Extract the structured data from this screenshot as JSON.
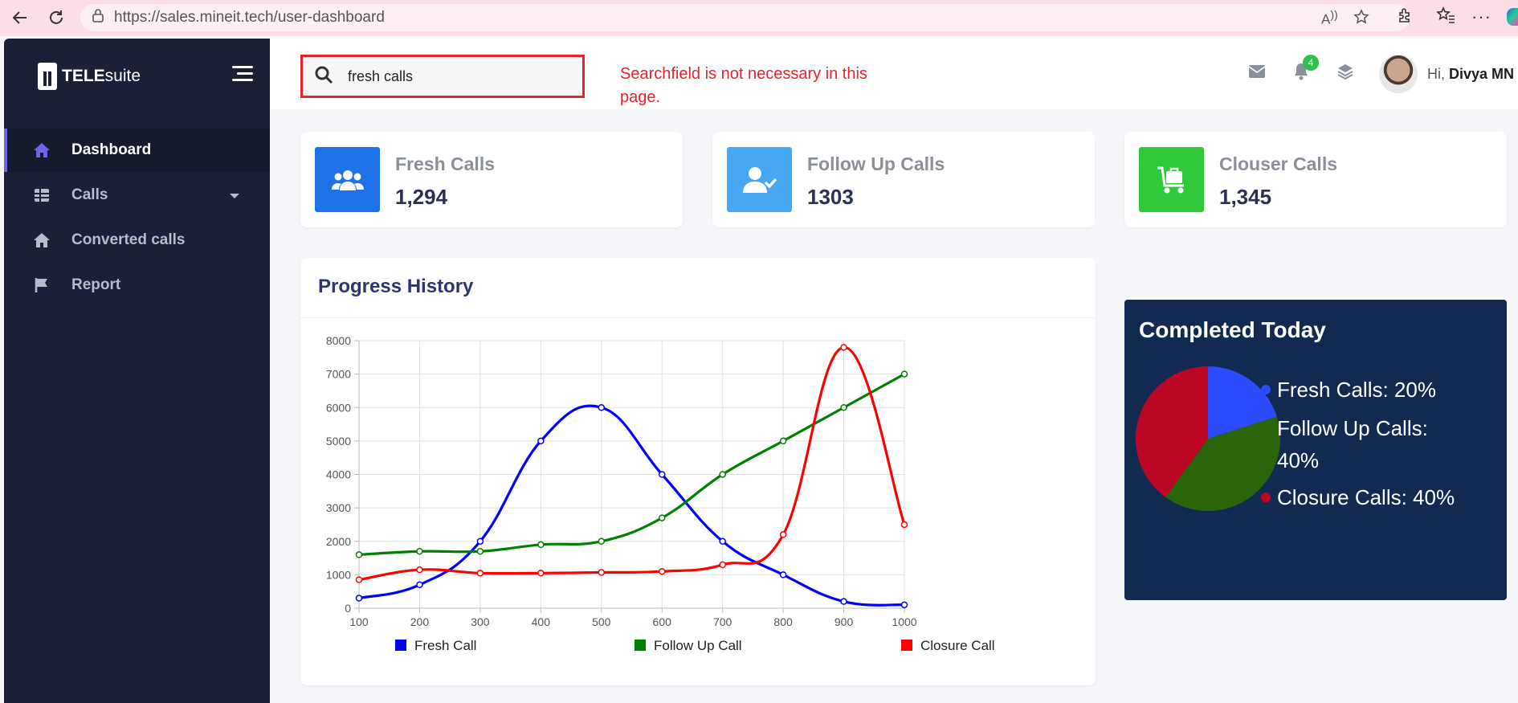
{
  "browser": {
    "url": "https://sales.mineit.tech/user-dashboard"
  },
  "sidebar": {
    "logo_bold": "TELE",
    "logo_light": "suite",
    "items": [
      {
        "label": "Dashboard",
        "icon": "home-icon",
        "active": true
      },
      {
        "label": "Calls",
        "icon": "table-icon",
        "has_caret": true
      },
      {
        "label": "Converted calls",
        "icon": "home-icon"
      },
      {
        "label": "Report",
        "icon": "flag-icon"
      }
    ]
  },
  "header": {
    "search_value": "fresh calls",
    "annotation": "Searchfield is not necessary in this page.",
    "notification_count": "4",
    "greeting_prefix": "Hi,",
    "user_name": "Divya MN"
  },
  "stats": [
    {
      "title": "Fresh Calls",
      "value": "1,294",
      "color": "#1d72e8",
      "icon": "users-icon"
    },
    {
      "title": "Follow Up Calls",
      "value": "1303",
      "color": "#46a7f5",
      "icon": "user-check-icon"
    },
    {
      "title": "Clouser Calls",
      "value": "1,345",
      "color": "#2fc93a",
      "icon": "luggage-icon"
    }
  ],
  "progress": {
    "title": "Progress History"
  },
  "chart_data": {
    "type": "line",
    "title": "Progress History",
    "x": [
      100,
      200,
      300,
      400,
      500,
      600,
      700,
      800,
      900,
      1000
    ],
    "ylim": [
      0,
      8000
    ],
    "yticks": [
      0,
      1000,
      2000,
      3000,
      4000,
      5000,
      6000,
      7000,
      8000
    ],
    "grid": true,
    "legend_position": "bottom",
    "series": [
      {
        "name": "Fresh Call",
        "color": "#0000ff",
        "values": [
          300,
          700,
          2000,
          5000,
          6000,
          4000,
          2000,
          1000,
          200,
          100
        ]
      },
      {
        "name": "Follow Up Call",
        "color": "#008000",
        "values": [
          1600,
          1700,
          1700,
          1900,
          2000,
          2700,
          4000,
          5000,
          6000,
          7000
        ]
      },
      {
        "name": "Closure Call",
        "color": "#ff0000",
        "values": [
          850,
          1150,
          1050,
          1050,
          1070,
          1100,
          1300,
          2200,
          7800,
          2500
        ]
      }
    ]
  },
  "completed": {
    "title": "Completed Today",
    "legend": [
      {
        "label": "Fresh Calls: 20%",
        "value": 20,
        "color": "#2a4bff"
      },
      {
        "label": "Follow Up Calls: 40%",
        "value": 40,
        "color": "#29650a"
      },
      {
        "label": "Closure Calls: 40%",
        "value": 40,
        "color": "#bb0624"
      }
    ]
  }
}
